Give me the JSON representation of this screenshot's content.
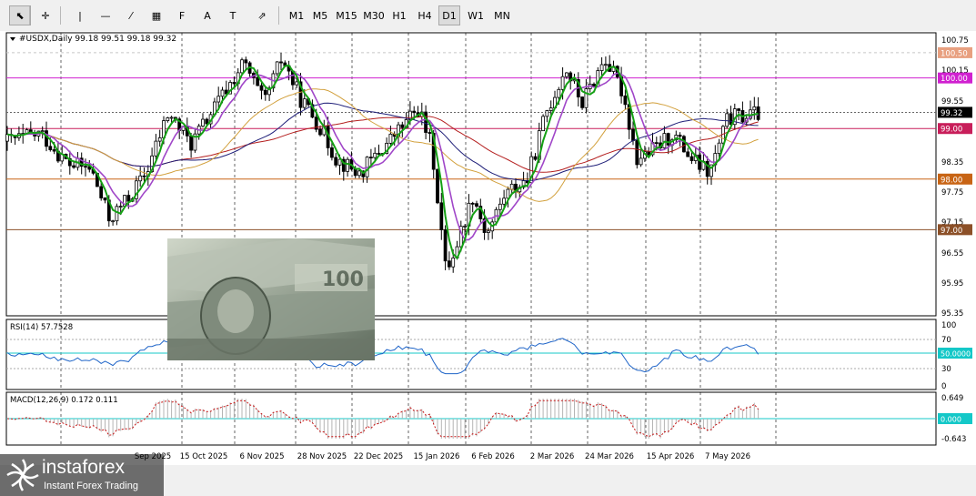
{
  "toolbar": {
    "tools": [
      {
        "name": "cursor-icon",
        "glyph": "⬉"
      },
      {
        "name": "crosshair-icon",
        "glyph": "✛"
      },
      {
        "name": "vertical-line-icon",
        "glyph": "|"
      },
      {
        "name": "horizontal-line-icon",
        "glyph": "—"
      },
      {
        "name": "trendline-icon",
        "glyph": "⁄"
      },
      {
        "name": "channel-icon",
        "glyph": "▦"
      },
      {
        "name": "fibonacci-icon",
        "glyph": "F"
      },
      {
        "name": "text-icon",
        "glyph": "A"
      },
      {
        "name": "text-label-icon",
        "glyph": "T"
      },
      {
        "name": "arrows-icon",
        "glyph": "⇗"
      }
    ],
    "timeframes": [
      "M1",
      "M5",
      "M15",
      "M30",
      "H1",
      "H4",
      "D1",
      "W1",
      "MN"
    ],
    "active_timeframe": "D1"
  },
  "main_chart": {
    "symbol_header": "#USDX,Daily  99.18 99.51 99.18 99.32",
    "price_labels": [
      "100.75",
      "100.15",
      "99.55",
      "98.95",
      "98.35",
      "97.75",
      "97.15",
      "96.55",
      "95.95",
      "95.35"
    ],
    "level_tags": [
      {
        "text": "100.50",
        "bg": "#e8a080"
      },
      {
        "text": "100.00",
        "bg": "#d020d0"
      },
      {
        "text": "99.32",
        "bg": "#000000"
      },
      {
        "text": "99.00",
        "bg": "#c81e5a"
      },
      {
        "text": "98.00",
        "bg": "#c86414"
      },
      {
        "text": "97.00",
        "bg": "#8c5028"
      }
    ]
  },
  "rsi": {
    "header": "RSI(14) 57.7528",
    "scale_labels": [
      "100",
      "70",
      "50.0000",
      "30",
      "0"
    ]
  },
  "macd": {
    "header": "MACD(12,26,9) 0.172 0.111",
    "scale_labels": [
      "0.649",
      "0.000",
      "-0.643"
    ]
  },
  "date_axis": [
    "15 Oct 2025",
    "6 Nov 2025",
    "28 Nov 2025",
    "22 Dec 2025",
    "15 Jan 2026",
    "6 Feb 2026",
    "2 Mar 2026",
    "24 Mar 2026",
    "15 Apr 2026",
    "7 May 2026"
  ],
  "date_axis_partial": [
    "Sep 2025"
  ],
  "logo": {
    "name": "instaforex",
    "tagline": "Instant Forex Trading"
  },
  "colors": {
    "candles": "#000000",
    "rsi_line": "#1e64c8",
    "macd_histogram": "#b4b4b4",
    "macd_signal": "#c81414",
    "ma_green": "#14a014",
    "ma_purple": "#a046c8",
    "ma_orange": "#d2a03c",
    "ma_navy": "#1e1e78",
    "ma_darkred": "#b41e1e"
  }
}
